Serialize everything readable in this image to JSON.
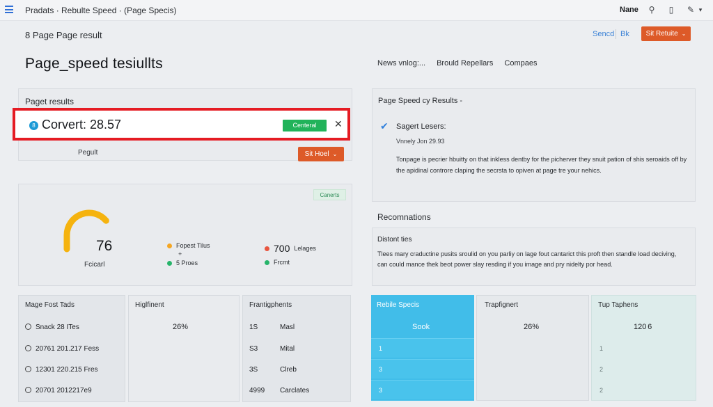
{
  "topbar": {
    "title": "Pradats · Rebulte Speed · (Page Specis)",
    "user_name": "Nane"
  },
  "breadcrumb": "8 Page Page result",
  "links": {
    "sencd": "Sencd",
    "bk": "Bk"
  },
  "buttons": {
    "top_action": "Sit Retuite",
    "mid_action": "Sit Hoel"
  },
  "page_title": "Page_speed tesiullts",
  "tabs": [
    "News vnlog:...",
    "Brould Repellars",
    "Compaes"
  ],
  "left_panel": {
    "title": "Paget results",
    "highlight": {
      "icon_letter": "8",
      "text": "Corvert: 28.57",
      "status": "Centeral"
    },
    "footer_label": "Pegult"
  },
  "right_panel": {
    "title": "Page Speed cy Results -",
    "item": "Sagert Lesers:",
    "sub": "Vnnely Jon 29.93",
    "para": "Tonpage is pecrier hbuitty on that inkless dentby for the picherver they snuit pation of shis seroaids off by the apidinal controre claping the secrsta to opiven at page tre your nehics."
  },
  "gauge": {
    "badge": "Canerts",
    "value": "76",
    "label": "Fcicarl",
    "fraction": 0.76,
    "legend": [
      {
        "label": "Fopest Tilus",
        "color": "#f5a623"
      },
      {
        "label": "+",
        "color": ""
      },
      {
        "label": "5 Proes",
        "color": "#27b46a"
      }
    ],
    "legend_right": {
      "value": "700",
      "value_label": "Lelages",
      "item": "Frcmt",
      "color_a": "#e8553f",
      "color_b": "#27b46a"
    }
  },
  "recommendations": {
    "heading": "Recomnations",
    "title": "Distont ties",
    "para": "Tlees mary craductine pusits sroulid on you parliy on lage fout cantarict this proft then standle load deciving, can could mance thek beot power slay resding if you image and pry nidelty por head."
  },
  "table_left": {
    "headers": [
      "Mage Fost Tads",
      "Higlfinent",
      "Frantigphents"
    ],
    "rows": [
      {
        "c1": "Snack 28 ITes",
        "c2": "26%",
        "c3a": "1S",
        "c3b": "Masl"
      },
      {
        "c1": "20761 201.217 Fess",
        "c2": "",
        "c3a": "S3",
        "c3b": "Mital"
      },
      {
        "c1": "12301 220.215 Fres",
        "c2": "",
        "c3a": "3S",
        "c3b": "Clreb"
      },
      {
        "c1": "20701 2012217e9",
        "c2": "",
        "c3a": "4999",
        "c3b": "Carclates"
      }
    ]
  },
  "table_right": {
    "headers": [
      "Rebile Specis",
      "Trapfignert",
      "Tup Taphens"
    ],
    "first_row": {
      "c1": "Sook",
      "c2": "26%",
      "c3": "120 6"
    },
    "rows": [
      {
        "c1": "1",
        "c3": "1"
      },
      {
        "c1": "3",
        "c3": "2"
      },
      {
        "c1": "3",
        "c3": "2"
      }
    ]
  },
  "colors": {
    "accent_orange": "#dd5a28",
    "highlight_red": "#e51b23",
    "status_green": "#21b35a",
    "table_blue": "#41bde9",
    "gauge_orange": "#f5b30f"
  }
}
